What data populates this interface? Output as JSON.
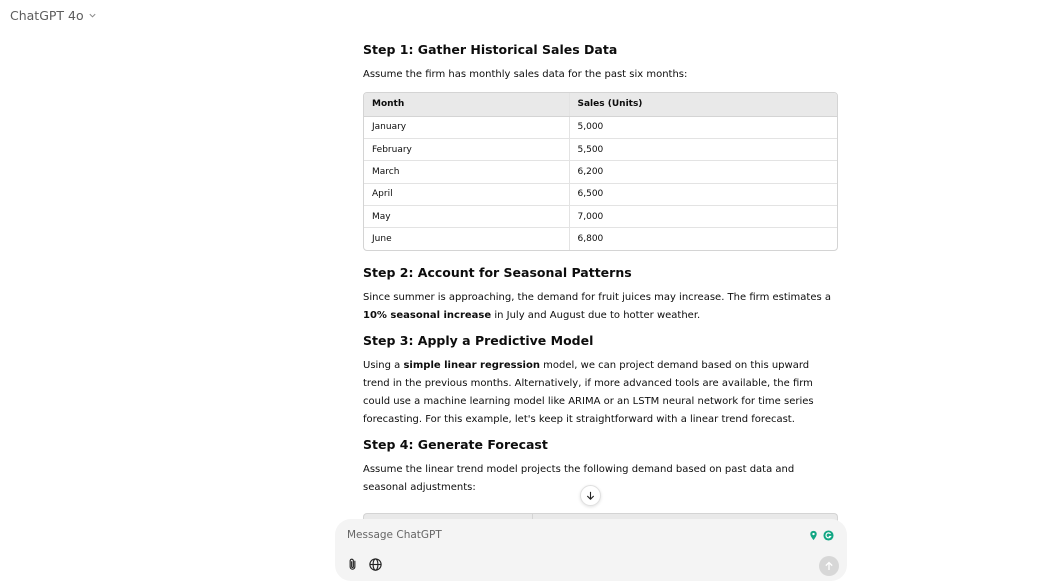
{
  "header": {
    "model_label": "ChatGPT 4o"
  },
  "step1": {
    "heading": "Step 1: Gather Historical Sales Data",
    "intro": "Assume the firm has monthly sales data for the past six months:",
    "columns": [
      "Month",
      "Sales (Units)"
    ],
    "rows": [
      [
        "January",
        "5,000"
      ],
      [
        "February",
        "5,500"
      ],
      [
        "March",
        "6,200"
      ],
      [
        "April",
        "6,500"
      ],
      [
        "May",
        "7,000"
      ],
      [
        "June",
        "6,800"
      ]
    ]
  },
  "step2": {
    "heading": "Step 2: Account for Seasonal Patterns",
    "text_before": "Since summer is approaching, the demand for fruit juices may increase. The firm estimates a ",
    "bold": "10% seasonal increase",
    "text_after": " in July and August due to hotter weather."
  },
  "step3": {
    "heading": "Step 3: Apply a Predictive Model",
    "text_before": "Using a ",
    "bold": "simple linear regression",
    "text_after": " model, we can project demand based on this upward trend in the previous months. Alternatively, if more advanced tools are available, the firm could use a machine learning model like ARIMA or an LSTM neural network for time series forecasting. For this example, let's keep it straightforward with a linear trend forecast."
  },
  "step4": {
    "heading": "Step 4: Generate Forecast",
    "text": "Assume the linear trend model projects the following demand based on past data and seasonal adjustments:"
  },
  "composer": {
    "placeholder": "Message ChatGPT"
  },
  "icons": {
    "model_chevron": "chevron-down-icon",
    "scroll_down": "arrow-down-icon",
    "attach": "paperclip-icon",
    "web": "globe-icon",
    "send": "arrow-up-icon",
    "ext1": "map-pin-icon",
    "ext2": "grammarly-icon"
  },
  "colors": {
    "table_header_bg": "#e9e9e9",
    "composer_bg": "#f4f4f4",
    "ext_green": "#11a683"
  }
}
